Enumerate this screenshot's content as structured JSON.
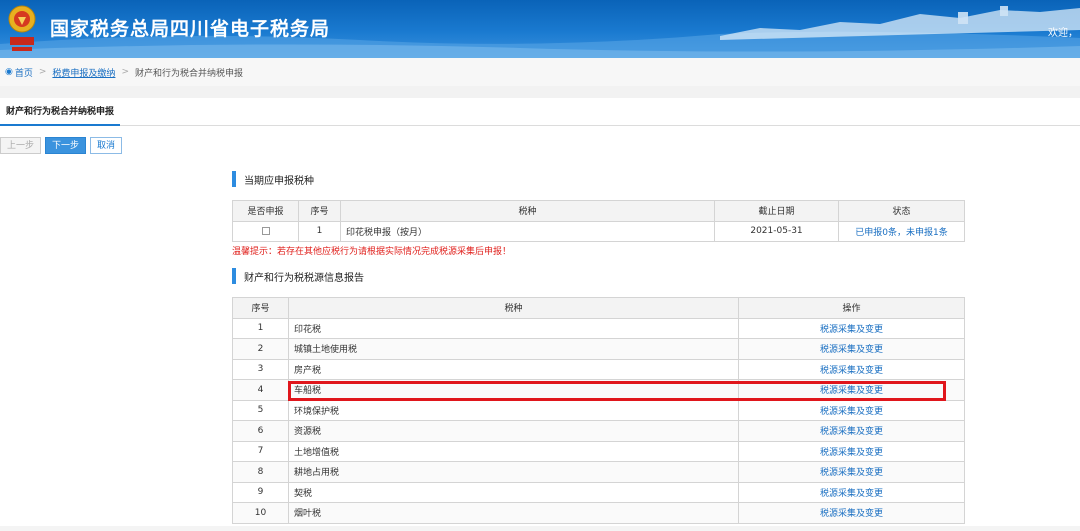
{
  "header": {
    "site_title": "国家税务总局四川省电子税务局",
    "welcome_text": "欢迎，"
  },
  "breadcrumb": {
    "home": "首页",
    "level1": "税费申报及缴纳",
    "current": "财产和行为税合并纳税申报"
  },
  "tab": {
    "label": "财产和行为税合并纳税申报"
  },
  "buttons": {
    "prev": "上一步",
    "next": "下一步",
    "cancel": "取消"
  },
  "section1": {
    "title": "当期应申报税种",
    "headers": [
      "是否申报",
      "序号",
      "税种",
      "截止日期",
      "状态"
    ],
    "rows": [
      {
        "seq": "1",
        "tax": "印花税申报（按月）",
        "deadline": "2021-05-31",
        "status": "已申报0条，未申报1条",
        "checked": false
      }
    ],
    "tip": "温馨提示：若存在其他应税行为请根据实际情况完成税源采集后申报！"
  },
  "section2": {
    "title": "财产和行为税税源信息报告",
    "headers": [
      "序号",
      "税种",
      "操作"
    ],
    "rows": [
      {
        "seq": "1",
        "tax": "印花税",
        "action": "税源采集及变更"
      },
      {
        "seq": "2",
        "tax": "城镇土地使用税",
        "action": "税源采集及变更"
      },
      {
        "seq": "3",
        "tax": "房产税",
        "action": "税源采集及变更"
      },
      {
        "seq": "4",
        "tax": "车船税",
        "action": "税源采集及变更"
      },
      {
        "seq": "5",
        "tax": "环境保护税",
        "action": "税源采集及变更"
      },
      {
        "seq": "6",
        "tax": "资源税",
        "action": "税源采集及变更"
      },
      {
        "seq": "7",
        "tax": "土地增值税",
        "action": "税源采集及变更"
      },
      {
        "seq": "8",
        "tax": "耕地占用税",
        "action": "税源采集及变更"
      },
      {
        "seq": "9",
        "tax": "契税",
        "action": "税源采集及变更"
      },
      {
        "seq": "10",
        "tax": "烟叶税",
        "action": "税源采集及变更"
      }
    ],
    "highlighted_row": "4"
  },
  "colors": {
    "accent": "#1a7ad0",
    "link": "#1a6fc2",
    "warning": "#e0201c",
    "highlight": "#e0161c"
  },
  "icons": {
    "emblem": "tax-emblem-icon",
    "location": "location-pin-icon"
  }
}
